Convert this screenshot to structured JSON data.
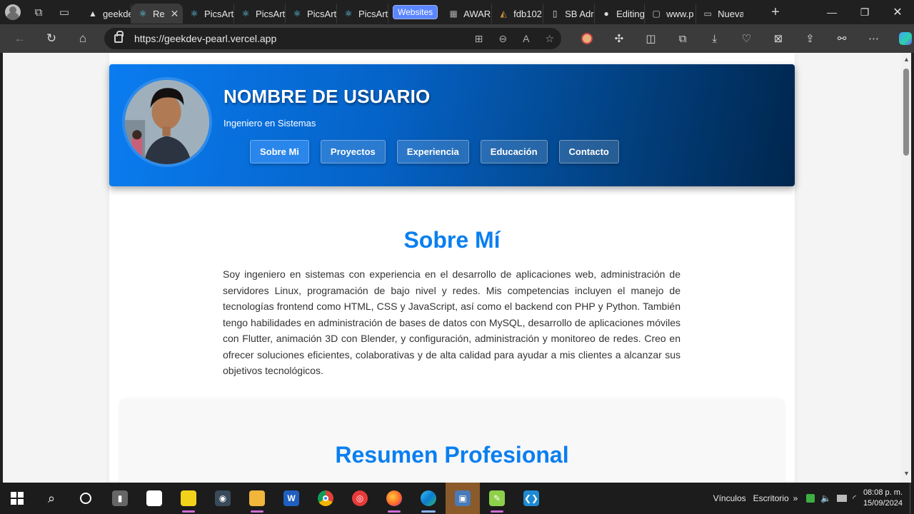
{
  "browser": {
    "tabs": [
      {
        "label": "geekde",
        "icon": "vercel-icon",
        "active": false
      },
      {
        "label": "Re",
        "icon": "react-icon",
        "active": true
      },
      {
        "label": "PicsArt",
        "icon": "react-icon",
        "active": false
      },
      {
        "label": "PicsArt",
        "icon": "react-icon",
        "active": false
      },
      {
        "label": "PicsArt",
        "icon": "react-icon",
        "active": false
      },
      {
        "label": "PicsArt",
        "icon": "react-icon",
        "active": false
      }
    ],
    "tab_group_label": "Websites",
    "tabs_after_group": [
      {
        "label": "AWARD",
        "icon": "page-icon"
      },
      {
        "label": "fdb102",
        "icon": "triangle-icon"
      },
      {
        "label": "SB Adr",
        "icon": "document-icon"
      },
      {
        "label": "Editing",
        "icon": "github-icon"
      },
      {
        "label": "www.p",
        "icon": "lock-page-icon"
      },
      {
        "label": "Nueva",
        "icon": "newtab-icon"
      }
    ],
    "url": "https://geekdev-pearl.vercel.app"
  },
  "page": {
    "header": {
      "title": "NOMBRE DE USUARIO",
      "subtitle": "Ingeniero en Sistemas",
      "nav": [
        "Sobre Mi",
        "Proyectos",
        "Experiencia",
        "Educación",
        "Contacto"
      ]
    },
    "about": {
      "title": "Sobre Mí",
      "text": "Soy ingeniero en sistemas con experiencia en el desarrollo de aplicaciones web, administración de servidores Linux, programación de bajo nivel y redes. Mis competencias incluyen el manejo de tecnologías frontend como HTML, CSS y JavaScript, así como el backend con PHP y Python. También tengo habilidades en administración de bases de datos con MySQL, desarrollo de aplicaciones móviles con Flutter, animación 3D con Blender, y configuración, administración y monitoreo de redes. Creo en ofrecer soluciones eficientes, colaborativas y de alta calidad para ayudar a mis clientes a alcanzar sus objetivos tecnológicos."
    },
    "summary": {
      "title": "Resumen Profesional"
    }
  },
  "taskbar": {
    "tray_links": "Vínculos",
    "tray_desktop": "Escritorio",
    "time": "08:08 p. m.",
    "date": "15/09/2024"
  },
  "colors": {
    "accent": "#0a7ff0",
    "hero_start": "#0a7cf0",
    "hero_end": "#00264d"
  }
}
